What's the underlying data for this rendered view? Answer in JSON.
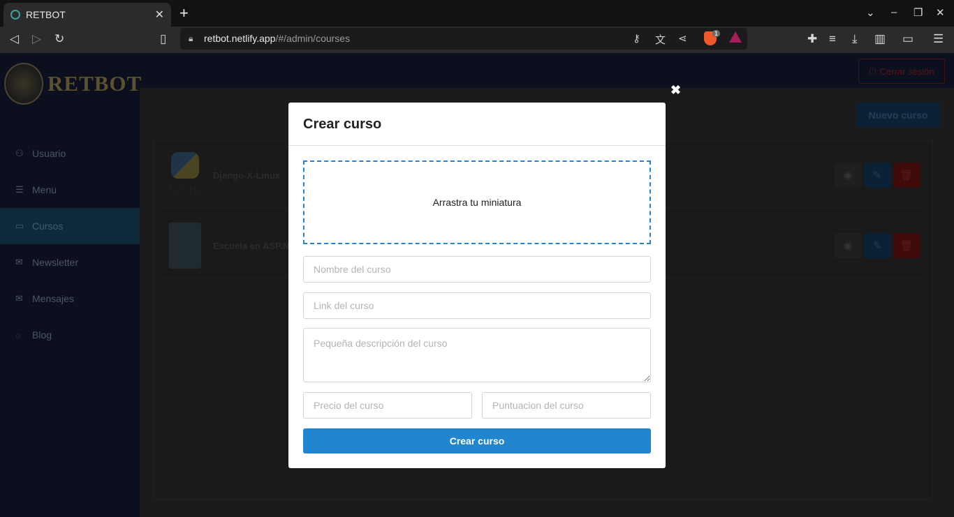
{
  "browser": {
    "tab_title": "RETBOT",
    "url_host": "retbot.netlify.app",
    "url_path": "/#/admin/courses",
    "brave_badge": "1"
  },
  "app": {
    "logo_text": "RETBOT",
    "logout_label": "Cerrar sesión",
    "new_course_label": "Nuevo curso",
    "nav": [
      {
        "label": "Usuario",
        "icon": "user-icon"
      },
      {
        "label": "Menu",
        "icon": "menu-icon"
      },
      {
        "label": "Cursos",
        "icon": "monitor-icon",
        "active": true
      },
      {
        "label": "Newsletter",
        "icon": "mail-icon"
      },
      {
        "label": "Mensajes",
        "icon": "mail-icon"
      },
      {
        "label": "Blog",
        "icon": "chat-icon"
      }
    ],
    "courses": [
      {
        "name": "Django-X-Linux",
        "thumb_text": "django"
      },
      {
        "name": "Escuela en ASP.N"
      }
    ]
  },
  "modal": {
    "close_symbol": "✖",
    "title": "Crear curso",
    "dropzone_text": "Arrastra tu miniatura",
    "name_placeholder": "Nombre del curso",
    "link_placeholder": "Link del curso",
    "description_placeholder": "Pequeña descripción del curso",
    "price_placeholder": "Precio del curso",
    "rating_placeholder": "Puntuacion del curso",
    "submit_label": "Crear curso"
  },
  "colors": {
    "primary": "#2185d0",
    "danger": "#db2828"
  }
}
